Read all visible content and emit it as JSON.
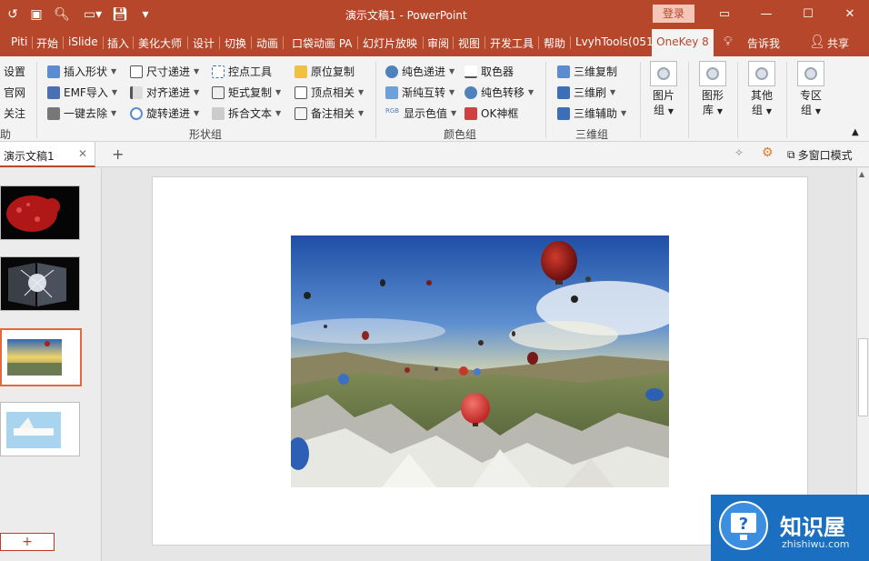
{
  "app": {
    "title": "演示文稿1 - PowerPoint",
    "login_label": "登录",
    "accent_color": "#b7472a"
  },
  "tabs": [
    "Piti",
    "开始",
    "iSlide",
    "插入",
    "美化大师",
    "设计",
    "切换",
    "动画",
    "口袋动画 PA",
    "幻灯片放映",
    "审阅",
    "视图",
    "开发工具",
    "帮助",
    "LvyhTools(051",
    "OneKey 8",
    "告诉我",
    "共享"
  ],
  "ribbon": {
    "left_items": [
      "设置",
      "官网",
      "关注",
      "助"
    ],
    "shape_group": {
      "col1": [
        "插入形状",
        "EMF导入",
        "一键去除"
      ],
      "col2": [
        "尺寸递进",
        "对齐递进",
        "旋转递进"
      ],
      "col3": [
        "控点工具",
        "矩式复制",
        "拆合文本"
      ],
      "col4": [
        "原位复制",
        "顶点相关",
        "备注相关"
      ],
      "label": "形状组"
    },
    "color_group": {
      "col1": [
        "纯色递进",
        "渐纯互转",
        "显示色值"
      ],
      "col2": [
        "取色器",
        "纯色转移",
        "OK神框"
      ],
      "label": "颜色组"
    },
    "threed_group": {
      "items": [
        "三维复制",
        "三维刷",
        "三维辅助"
      ],
      "label": "三维组"
    },
    "big_buttons": [
      {
        "line1": "图片",
        "line2": "组"
      },
      {
        "line1": "图形",
        "line2": "库"
      },
      {
        "line1": "其他",
        "line2": "组"
      },
      {
        "line1": "专区",
        "line2": "组"
      }
    ]
  },
  "docbar": {
    "doc_tab": "演示文稿1",
    "multi_window": "多窗口模式"
  },
  "watermark": {
    "title": "知识屋",
    "url": "zhishiwu.com"
  }
}
